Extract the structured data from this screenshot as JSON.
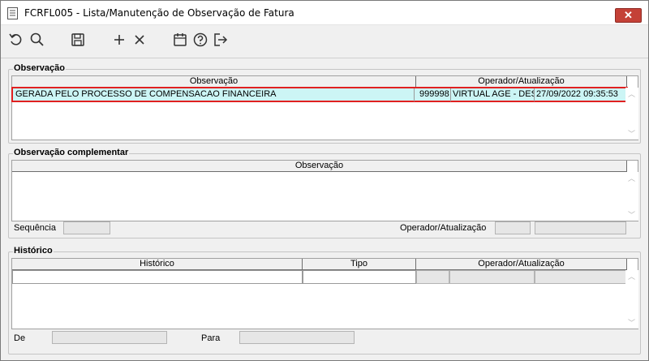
{
  "window": {
    "title": "FCRFL005 - Lista/Manutenção de Observação de Fatura",
    "close_label": "✕"
  },
  "toolbar": {
    "icons": [
      "undo-icon",
      "search-icon",
      "save-icon",
      "add-icon",
      "delete-icon",
      "calendar-icon",
      "help-icon",
      "exit-icon"
    ]
  },
  "observacao": {
    "legend": "Observação",
    "headers": [
      "Observação",
      "Operador/Atualização"
    ],
    "row": {
      "observacao": "GERADA PELO PROCESSO DE COMPENSACAO FINANCEIRA",
      "operador_codigo": "999998",
      "operador_nome": "VIRTUAL AGE - DESE",
      "atualizacao": "27/09/2022 09:35:53"
    },
    "selection_color": "#ccf5f5",
    "highlight_color": "#e02020"
  },
  "complementar": {
    "legend": "Observação complementar",
    "header": "Observação",
    "sequencia_label": "Sequência",
    "operador_label": "Operador/Atualização"
  },
  "historico": {
    "legend": "Histórico",
    "headers": [
      "Histórico",
      "Tipo",
      "Operador/Atualização"
    ],
    "de_label": "De",
    "para_label": "Para"
  }
}
